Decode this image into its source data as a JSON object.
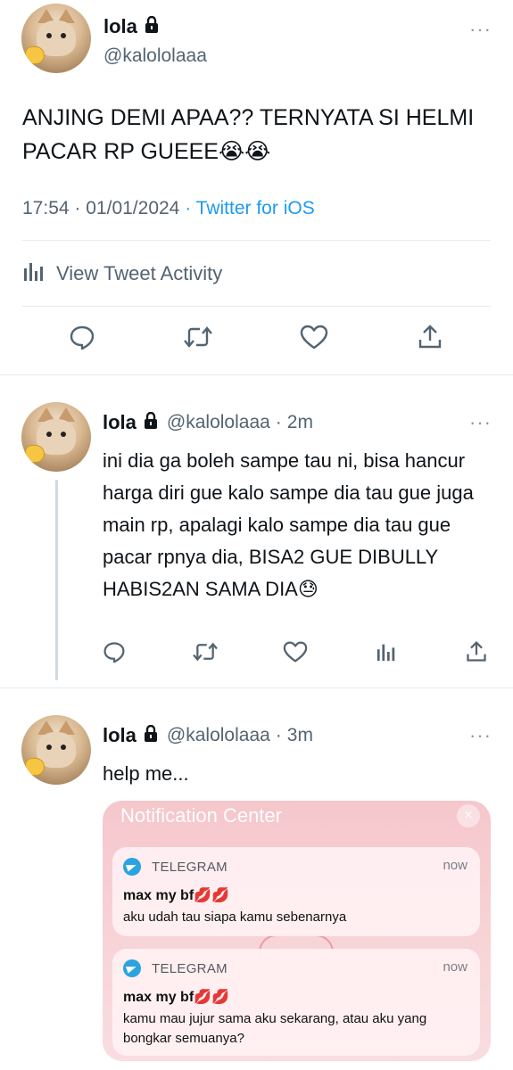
{
  "main_tweet": {
    "name": "lola",
    "handle": "@kalololaaa",
    "text": "ANJING DEMI APAA?? TERNYATA SI HELMI PACAR RP GUEEE😭😭",
    "time": "17:54",
    "separator": "·",
    "date": "01/01/2024",
    "source": "Twitter for iOS",
    "activity_label": "View Tweet Activity",
    "more": "···"
  },
  "replies": [
    {
      "name": "lola",
      "handle": "@kalololaaa",
      "time_ago": "2m",
      "separator": "·",
      "text": "ini dia ga boleh sampe tau ni, bisa hancur harga diri gue kalo sampe dia tau gue juga main rp, apalagi kalo sampe dia tau gue pacar rpnya dia, BISA2 GUE DIBULLY HABIS2AN SAMA DIA😓",
      "more": "···"
    },
    {
      "name": "lola",
      "handle": "@kalololaaa",
      "time_ago": "3m",
      "separator": "·",
      "text": "help me...",
      "more": "···"
    }
  ],
  "notification_center": {
    "title": "Notification Center",
    "close_icon": "×",
    "notifications": [
      {
        "app": "TELEGRAM",
        "time": "now",
        "sender": "max my bf💋💋",
        "message": "aku udah tau siapa kamu sebenarnya"
      },
      {
        "app": "TELEGRAM",
        "time": "now",
        "sender": "max my bf💋💋",
        "message": "kamu mau jujur sama aku sekarang, atau aku yang bongkar semuanya?"
      }
    ]
  },
  "colors": {
    "text": "#0f1419",
    "secondary": "#536471",
    "link": "#1d9bf0",
    "divider": "#e6ecf0",
    "notification_bg": "#f5c7cc",
    "telegram": "#2aa3df"
  },
  "icons": [
    "lock-icon",
    "reply-icon",
    "retweet-icon",
    "like-icon",
    "share-icon",
    "analytics-icon",
    "more-icon",
    "telegram-icon",
    "close-icon"
  ]
}
